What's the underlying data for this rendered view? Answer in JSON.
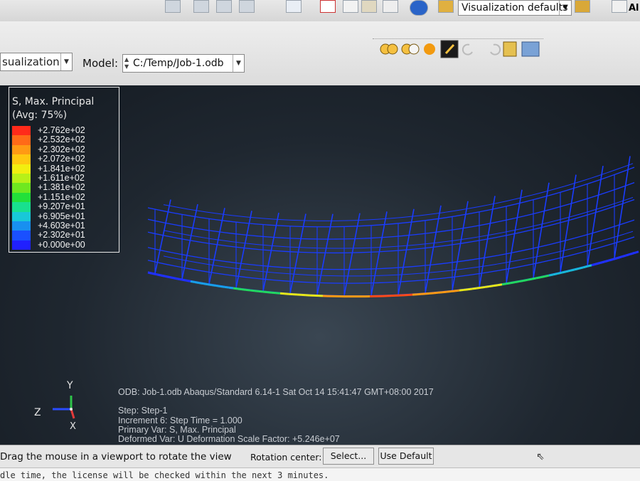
{
  "toolbar": {
    "visualization_defaults": "Visualization defaults",
    "al_label": "Al"
  },
  "context_bar": {
    "module": "sualization",
    "model_label": "Model:",
    "model_path": "C:/Temp/Job-1.odb"
  },
  "legend": {
    "title": "S, Max. Principal",
    "subtitle": "(Avg: 75%)",
    "entries": [
      {
        "value": "+2.762e+02",
        "color": "#ff2a1a"
      },
      {
        "value": "+2.532e+02",
        "color": "#ff6a18"
      },
      {
        "value": "+2.302e+02",
        "color": "#ff9a14"
      },
      {
        "value": "+2.072e+02",
        "color": "#ffc810"
      },
      {
        "value": "+1.841e+02",
        "color": "#f2ee10"
      },
      {
        "value": "+1.611e+02",
        "color": "#b8f018"
      },
      {
        "value": "+1.381e+02",
        "color": "#6fe820"
      },
      {
        "value": "+1.151e+02",
        "color": "#22e03a"
      },
      {
        "value": "+9.207e+01",
        "color": "#18e08e"
      },
      {
        "value": "+6.905e+01",
        "color": "#18c8d8"
      },
      {
        "value": "+4.603e+01",
        "color": "#1890f0"
      },
      {
        "value": "+2.302e+01",
        "color": "#1a50ff"
      },
      {
        "value": "+0.000e+00",
        "color": "#2020ff"
      }
    ]
  },
  "info": {
    "odb_line": "ODB: Job-1.odb   Abaqus/Standard 6.14-1   Sat Oct 14 15:41:47 GMT+08:00 2017",
    "step": "Step: Step-1",
    "increment": "Increment      6: Step Time =      1.000",
    "primary_var": "Primary Var: S, Max. Principal",
    "deformed_var": "Deformed Var: U   Deformation Scale Factor: +5.246e+07"
  },
  "triad": {
    "y_label": "Y",
    "z_label": "Z",
    "x_label": "X"
  },
  "prompt": {
    "text": "Drag the mouse in a viewport to rotate the view",
    "rotation_label": "Rotation center:",
    "select_button": "Select...",
    "default_button": "Use Default"
  },
  "message": {
    "text": "dle time, the license will be checked within the next 3 minutes."
  },
  "colors": {
    "mesh": "#1a3cff",
    "viewport_bg": "#1f2730",
    "legend_border": "#e8e8e8"
  }
}
